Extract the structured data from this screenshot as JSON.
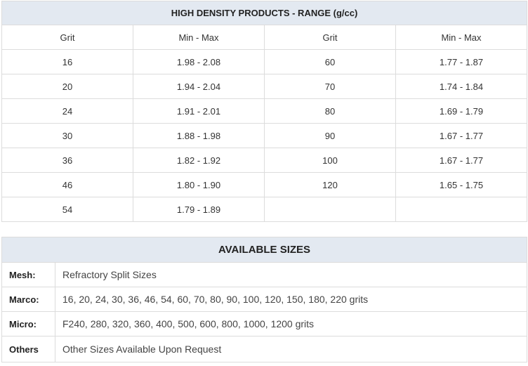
{
  "density_table": {
    "title": "HIGH DENSITY PRODUCTS - RANGE (g/cc)",
    "headers": [
      "Grit",
      "Min - Max",
      "Grit",
      "Min - Max"
    ],
    "rows": [
      [
        "16",
        "1.98 - 2.08",
        "60",
        "1.77 - 1.87"
      ],
      [
        "20",
        "1.94 - 2.04",
        "70",
        "1.74 - 1.84"
      ],
      [
        "24",
        "1.91 - 2.01",
        "80",
        "1.69 - 1.79"
      ],
      [
        "30",
        "1.88 - 1.98",
        "90",
        "1.67 - 1.77"
      ],
      [
        "36",
        "1.82 - 1.92",
        "100",
        "1.67 - 1.77"
      ],
      [
        "46",
        "1.80 - 1.90",
        "120",
        "1.65 - 1.75"
      ],
      [
        "54",
        "1.79 - 1.89",
        "",
        ""
      ]
    ]
  },
  "sizes_table": {
    "title": "AVAILABLE SIZES",
    "rows": [
      {
        "label": "Mesh:",
        "value": "Refractory Split Sizes"
      },
      {
        "label": "Marco:",
        "value": "16, 20, 24, 30, 36, 46, 54, 60, 70, 80, 90, 100, 120, 150, 180, 220 grits"
      },
      {
        "label": "Micro:",
        "value": "F240, 280, 320, 360, 400, 500, 600, 800, 1000, 1200 grits"
      },
      {
        "label": "Others",
        "value": "Other Sizes Available Upon Request"
      }
    ]
  }
}
